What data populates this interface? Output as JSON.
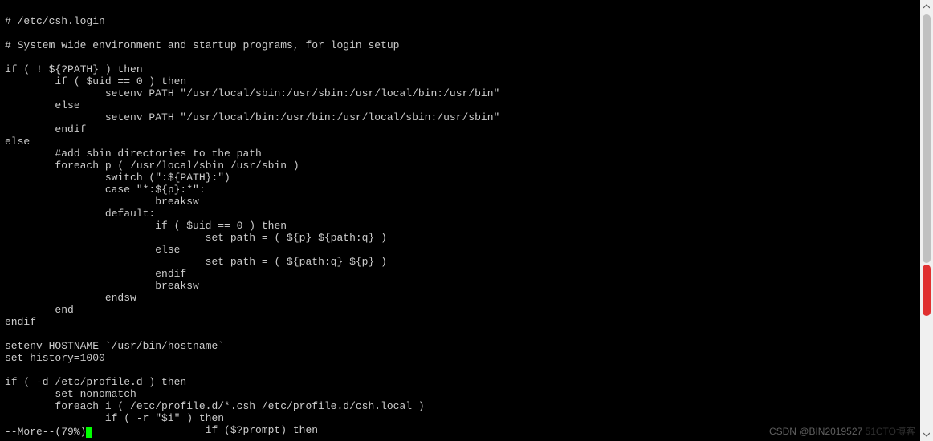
{
  "terminal": {
    "lines": [
      "# /etc/csh.login",
      "",
      "# System wide environment and startup programs, for login setup",
      "",
      "if ( ! ${?PATH} ) then",
      "        if ( $uid == 0 ) then",
      "                setenv PATH \"/usr/local/sbin:/usr/sbin:/usr/local/bin:/usr/bin\"",
      "        else",
      "                setenv PATH \"/usr/local/bin:/usr/bin:/usr/local/sbin:/usr/sbin\"",
      "        endif",
      "else",
      "        #add sbin directories to the path",
      "        foreach p ( /usr/local/sbin /usr/sbin )",
      "                switch (\":${PATH}:\")",
      "                case \"*:${p}:*\":",
      "                        breaksw",
      "                default:",
      "                        if ( $uid == 0 ) then",
      "                                set path = ( ${p} ${path:q} )",
      "                        else",
      "                                set path = ( ${path:q} ${p} )",
      "                        endif",
      "                        breaksw",
      "                endsw",
      "        end",
      "endif",
      "",
      "setenv HOSTNAME `/usr/bin/hostname`",
      "set history=1000",
      "",
      "if ( -d /etc/profile.d ) then",
      "        set nonomatch",
      "        foreach i ( /etc/profile.d/*.csh /etc/profile.d/csh.local )",
      "                if ( -r \"$i\" ) then",
      "                                if ($?prompt) then"
    ],
    "status": "--More--(79%)"
  },
  "watermark": {
    "main": "CSDN @BIN2019527",
    "faded": "51CTO博客"
  }
}
